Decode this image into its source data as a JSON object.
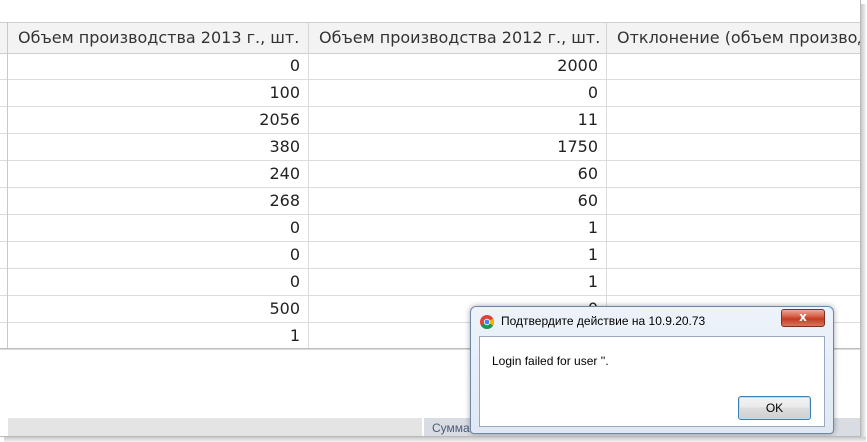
{
  "table": {
    "columns": [
      "Объем производства 2013 г., шт.",
      "Объем производства 2012 г., шт.",
      "Отклонение (объем производ"
    ],
    "rows": [
      [
        "0",
        "2000",
        ""
      ],
      [
        "100",
        "0",
        ""
      ],
      [
        "2056",
        "11",
        ""
      ],
      [
        "380",
        "1750",
        ""
      ],
      [
        "240",
        "60",
        ""
      ],
      [
        "268",
        "60",
        ""
      ],
      [
        "0",
        "1",
        ""
      ],
      [
        "0",
        "1",
        ""
      ],
      [
        "0",
        "1",
        ""
      ],
      [
        "500",
        "0",
        ""
      ],
      [
        "1",
        "",
        ""
      ]
    ]
  },
  "footer": {
    "label": "Сумма"
  },
  "dialog": {
    "title": "Подтвердите действие на 10.9.20.73",
    "message": "Login failed for user ''.",
    "ok_label": "OK",
    "close_symbol": "x",
    "icon": "chrome-icon"
  }
}
